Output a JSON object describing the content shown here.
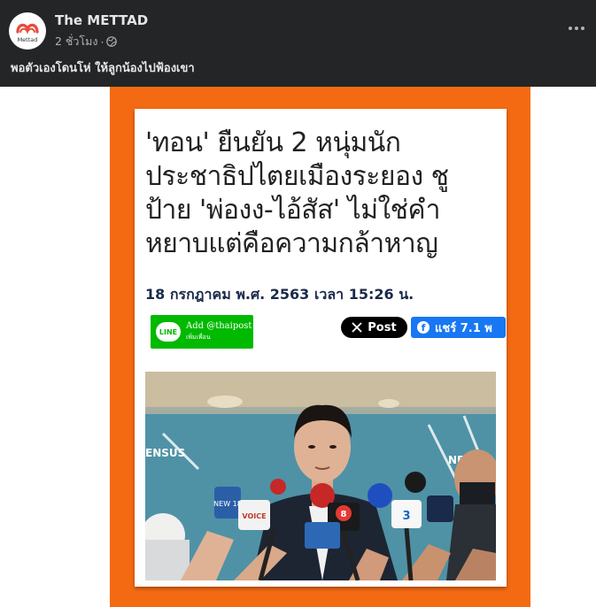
{
  "post": {
    "page_name": "The METTAD",
    "avatar_text": "Mettad",
    "time": "2 ชั่วโมง",
    "separator": "·",
    "caption": "พอตัวเองโดนโห่ ให้ลูกน้องไปฟ้องเขา"
  },
  "article": {
    "headline_lines": [
      "'ทอน' ยืนยัน 2 หนุ่มนัก",
      "ประชาธิปไตยเมืองระยอง ชู",
      "ป้าย 'พ่องง-ไอ้สัส' ไม่ใช่คำ",
      "หยาบแต่คือความกล้าหาญ"
    ],
    "date": "18 กรกฎาคม พ.ศ. 2563 เวลา 15:26 น.",
    "line_logo": "LINE",
    "line_add": "Add @thaipost",
    "line_sub": "เพิ่มเพื่อน",
    "x_post": "Post",
    "fb_share": "แชร์ 7.1 พ",
    "banner_left": "ENSUS",
    "banner_right": "NEW",
    "mic_labels": [
      "NEW 18",
      "VOICE",
      "3",
      "8"
    ]
  },
  "colors": {
    "bg_dark": "#242526",
    "orange": "#f46a12",
    "line_green": "#00b900",
    "fb_blue": "#1877f2"
  }
}
